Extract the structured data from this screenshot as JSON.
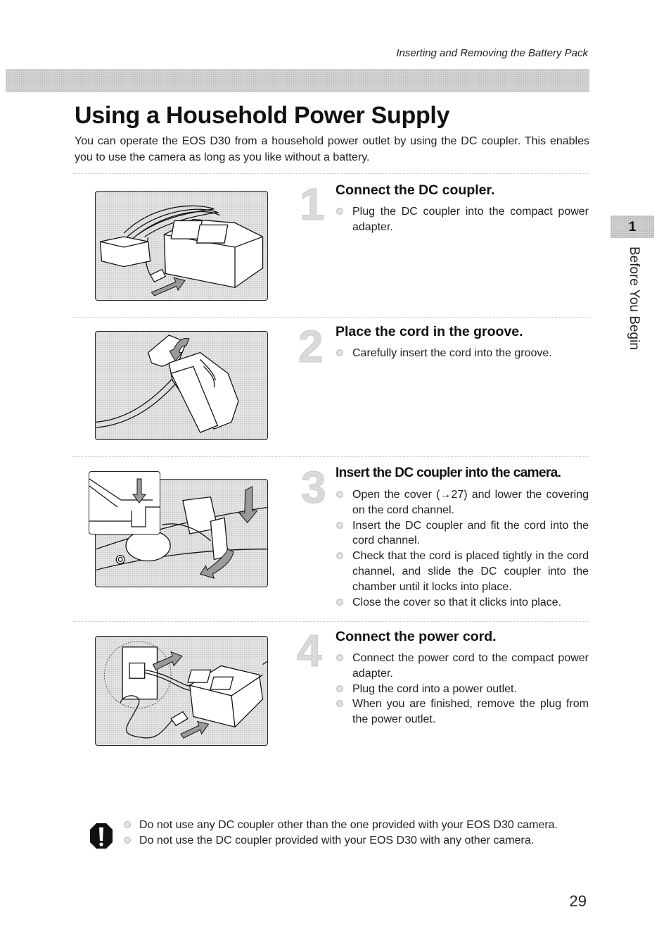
{
  "header": {
    "running_title": "Inserting and Removing the Battery Pack"
  },
  "page_title": "Using a Household Power Supply",
  "intro": "You can operate the EOS D30 from a household power outlet by using the DC coupler. This enables you to use the camera as long as you like without a battery.",
  "chapter_tab": {
    "number": "1",
    "label": "Before You Begin"
  },
  "steps": [
    {
      "number": "1",
      "title": "Connect the DC coupler.",
      "figure": "dc-coupler-and-compact-power-adapter-illustration",
      "bullets": [
        "Plug the DC coupler into the compact power adapter."
      ]
    },
    {
      "number": "2",
      "title": "Place the cord in the groove.",
      "figure": "cord-in-groove-illustration",
      "bullets": [
        "Carefully insert the cord into the groove."
      ]
    },
    {
      "number": "3",
      "title": "Insert the DC coupler into the camera.",
      "figure": "dc-coupler-into-camera-illustration",
      "bullets": [
        "Open the cover (→27) and lower the covering on the cord channel.",
        "Insert the DC coupler and fit the cord into the cord channel.",
        "Check that the cord is placed tightly in the cord channel, and slide the DC coupler into the chamber until it locks into place.",
        "Close the cover so that it clicks into place."
      ]
    },
    {
      "number": "4",
      "title": "Connect the power cord.",
      "figure": "power-cord-to-outlet-illustration",
      "bullets": [
        "Connect the power cord to the compact power adapter.",
        "Plug the cord into a power outlet.",
        "When you are finished, remove the plug from the power outlet."
      ]
    }
  ],
  "caution": {
    "icon": "caution-exclamation-icon",
    "items": [
      "Do not use any DC coupler other than the one provided with your EOS D30 camera.",
      "Do not use the DC coupler provided with your EOS D30 with any other camera."
    ]
  },
  "page_number": "29"
}
